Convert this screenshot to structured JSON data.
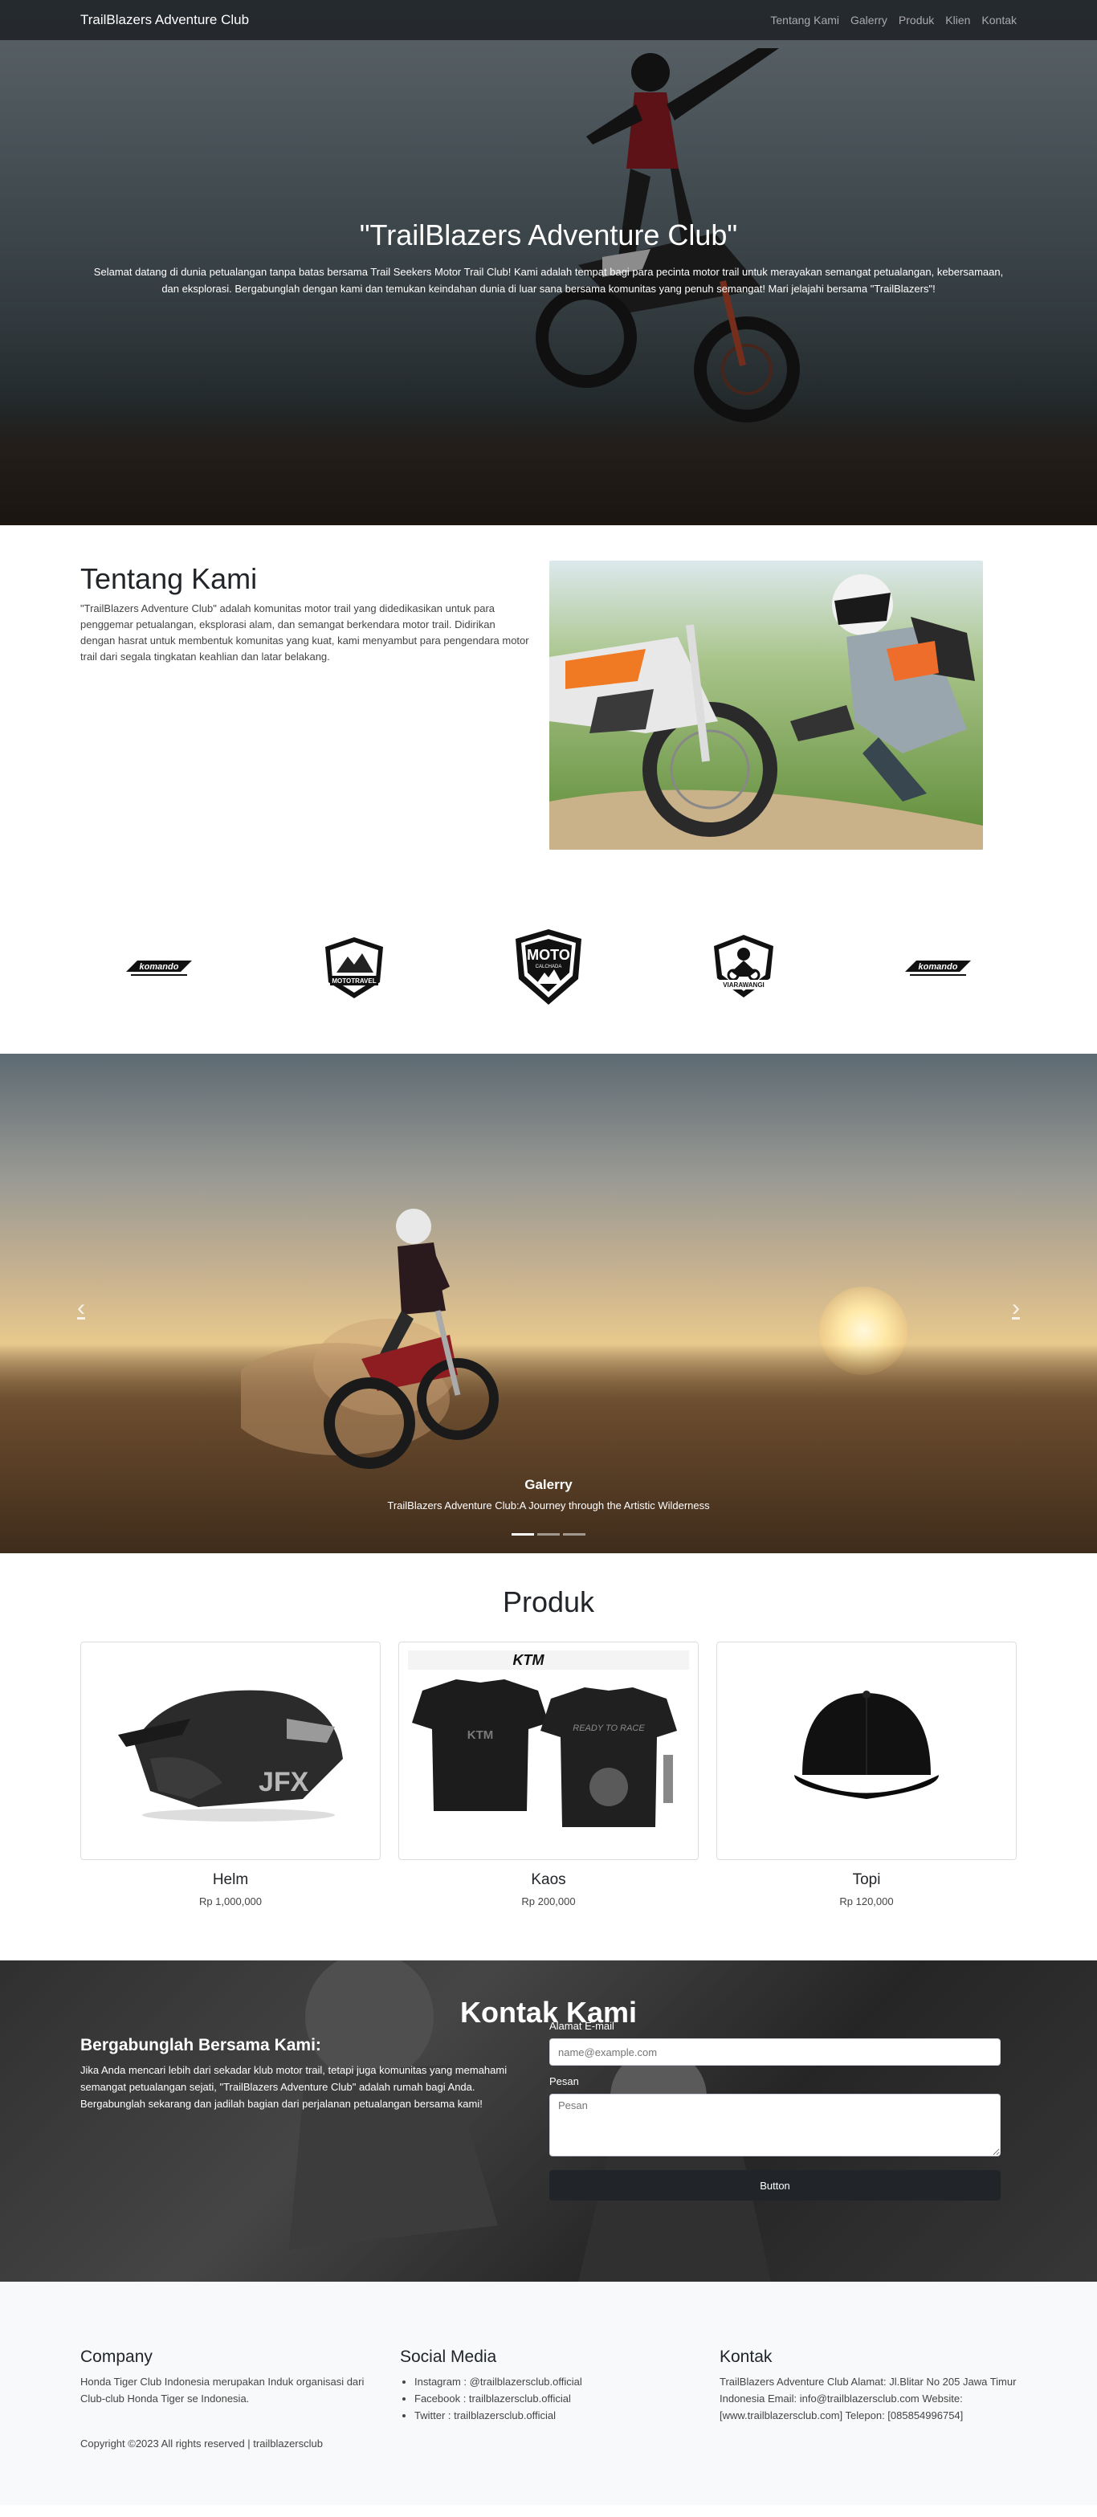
{
  "nav": {
    "brand": "TrailBlazers Adventure Club",
    "links": [
      "Tentang Kami",
      "Galerry",
      "Produk",
      "Klien",
      "Kontak"
    ]
  },
  "hero": {
    "title": "\"TrailBlazers Adventure Club\"",
    "text": "Selamat datang di dunia petualangan tanpa batas bersama Trail Seekers Motor Trail Club! Kami adalah tempat bagi para pecinta motor trail untuk merayakan semangat petualangan, kebersamaan, dan eksplorasi. Bergabunglah dengan kami dan temukan keindahan dunia di luar sana bersama komunitas yang penuh semangat! Mari jelajahi bersama \"TrailBlazers\"!"
  },
  "about": {
    "title": "Tentang Kami",
    "text": "\"TrailBlazers Adventure Club\" adalah komunitas motor trail yang didedikasikan untuk para penggemar petualangan, eksplorasi alam, dan semangat berkendara motor trail. Didirikan dengan hasrat untuk membentuk komunitas yang kuat, kami menyambut para pengendara motor trail dari segala tingkatan keahlian dan latar belakang."
  },
  "clients": {
    "logos": [
      "komando",
      "MOTOTRAVEL",
      "MOTO",
      "VIARAWANGI",
      "komando"
    ],
    "moto_sub": "CALCHADA"
  },
  "gallery": {
    "caption_title": "Galerry",
    "caption_text": "TrailBlazers Adventure Club:A Journey through the Artistic Wilderness",
    "prev": "‹",
    "next": "›"
  },
  "products": {
    "title": "Produk",
    "items": [
      {
        "name": "Helm",
        "price": "Rp 1,000,000"
      },
      {
        "name": "Kaos",
        "price": "Rp 200,000"
      },
      {
        "name": "Topi",
        "price": "Rp 120,000"
      }
    ],
    "shirt_brand": "KTM",
    "shirt_tag": "READY TO RACE",
    "helmet_brand": "JFX"
  },
  "contact": {
    "title": "Kontak Kami",
    "join_title": "Bergabunglah Bersama Kami:",
    "join_text": "Jika Anda mencari lebih dari sekadar klub motor trail, tetapi juga komunitas yang memahami semangat petualangan sejati, \"TrailBlazers Adventure Club\" adalah rumah bagi Anda. Bergabunglah sekarang dan jadilah bagian dari perjalanan petualangan bersama kami!",
    "email_label": "Alamat E-mail",
    "email_placeholder": "name@example.com",
    "message_label": "Pesan",
    "message_placeholder": "Pesan",
    "button": "Button"
  },
  "footer": {
    "company_title": "Company",
    "company_text": "Honda Tiger Club Indonesia merupakan Induk organisasi dari Club-club Honda Tiger se Indonesia.",
    "social_title": "Social Media",
    "social": [
      "Instagram : @trailblazersclub.official",
      "Facebook : trailblazersclub.official",
      "Twitter : trailblazersclub.official"
    ],
    "contact_title": "Kontak",
    "contact_text": "TrailBlazers Adventure Club Alamat: Jl.Blitar No 205 Jawa Timur Indonesia Email: info@trailblazersclub.com Website: [www.trailblazersclub.com] Telepon: [085854996754]",
    "copyright": "Copyright ©2023 All rights reserved | trailblazersclub"
  }
}
